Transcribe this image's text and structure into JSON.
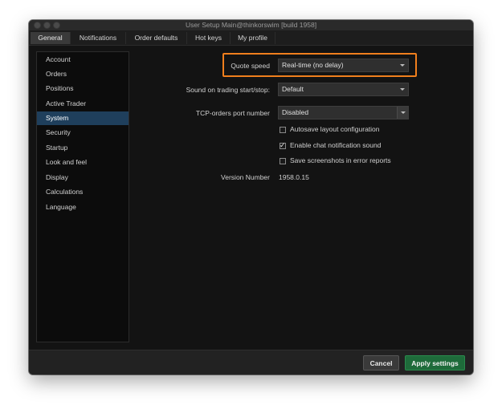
{
  "window": {
    "title": "User Setup Main@thinkorswim [build 1958]"
  },
  "tabs": [
    {
      "label": "General",
      "active": true
    },
    {
      "label": "Notifications",
      "active": false
    },
    {
      "label": "Order defaults",
      "active": false
    },
    {
      "label": "Hot keys",
      "active": false
    },
    {
      "label": "My profile",
      "active": false
    }
  ],
  "sidebar": {
    "items": [
      {
        "label": "Account"
      },
      {
        "label": "Orders"
      },
      {
        "label": "Positions"
      },
      {
        "label": "Active Trader"
      },
      {
        "label": "System",
        "selected": true
      },
      {
        "label": "Security"
      },
      {
        "label": "Startup"
      },
      {
        "label": "Look and feel"
      },
      {
        "label": "Display"
      },
      {
        "label": "Calculations"
      },
      {
        "label": "Language"
      }
    ]
  },
  "settings": {
    "quote_speed": {
      "label": "Quote speed",
      "value": "Real-time (no delay)"
    },
    "sound": {
      "label": "Sound on trading start/stop:",
      "value": "Default"
    },
    "tcp_port": {
      "label": "TCP-orders port number",
      "value": "Disabled"
    },
    "autosave": {
      "label": "Autosave layout configuration",
      "checked": false
    },
    "chat_sound": {
      "label": "Enable chat notification sound",
      "checked": true
    },
    "screenshots": {
      "label": "Save screenshots in error reports",
      "checked": false
    },
    "version": {
      "label": "Version Number",
      "value": "1958.0.15"
    }
  },
  "footer": {
    "cancel_label": "Cancel",
    "apply_label": "Apply settings"
  },
  "colors": {
    "highlight": "#f07f1d",
    "selected_sidebar": "#1f3f5c",
    "apply_button": "#1e6b3a"
  }
}
